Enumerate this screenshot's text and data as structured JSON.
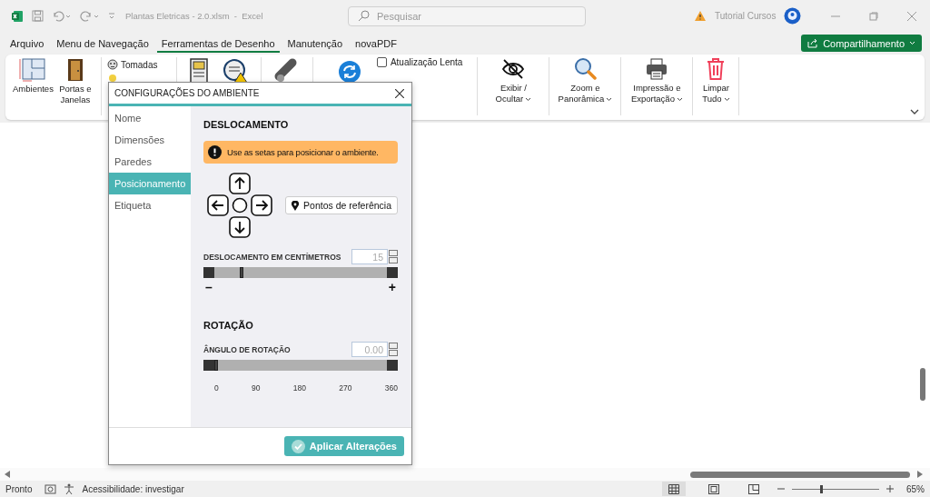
{
  "title_bar": {
    "file_title": "Plantas Eletricas - 2.0.xlsm  -  Excel",
    "search_placeholder": "Pesquisar",
    "account": "Tutorial Cursos"
  },
  "menu_tabs": [
    {
      "label": "Arquivo",
      "selected": false
    },
    {
      "label": "Menu de Navegação",
      "selected": false
    },
    {
      "label": "Ferramentas de Desenho",
      "selected": true
    },
    {
      "label": "Manutenção",
      "selected": false
    },
    {
      "label": "novaPDF",
      "selected": false
    }
  ],
  "share_button": "Compartilhamento",
  "ribbon": {
    "ambientes": "Ambientes",
    "portas": "Portas e Janelas",
    "tomadas": "Tomadas",
    "checkbox": {
      "label": "Atualização Lenta",
      "checked": false
    },
    "menus": [
      {
        "label": "Exibir / Ocultar",
        "dropdown": true
      },
      {
        "label": "Zoom e Panorâmica",
        "dropdown": true
      },
      {
        "label": "Impressão e Exportação",
        "dropdown": true
      },
      {
        "label": "Limpar Tudo",
        "dropdown": true
      }
    ]
  },
  "dialog": {
    "title": "CONFIGURAÇÕES DO AMBIENTE",
    "nav": [
      {
        "label": "Nome",
        "selected": false
      },
      {
        "label": "Dimensões",
        "selected": false
      },
      {
        "label": "Paredes",
        "selected": false
      },
      {
        "label": "Posicionamento",
        "selected": true
      },
      {
        "label": "Etiqueta",
        "selected": false
      }
    ],
    "offset_heading": "DESLOCAMENTO",
    "alert": "Use as setas para posicionar o ambiente.",
    "reference_button": "Pontos de referência",
    "offset_label": "DESLOCAMENTO EM CENTÍMETROS",
    "offset_value": "15",
    "offset_slider": {
      "level": 0.15
    },
    "minus": "–",
    "plus": "+",
    "rotation_heading": "ROTAÇÃO",
    "angle_label": "ÂNGULO DE ROTAÇÃO",
    "angle_value": "0.00",
    "angle_slider": {
      "level": 0
    },
    "angle_ticks": [
      "0",
      "90",
      "180",
      "270",
      "360"
    ],
    "apply_button": "Aplicar Alterações"
  },
  "status_bar": {
    "ready": "Pronto",
    "accessibility": "Acessibilidade: investigar",
    "zoom_slider": {
      "level": 0.32
    },
    "zoom": "65%"
  }
}
